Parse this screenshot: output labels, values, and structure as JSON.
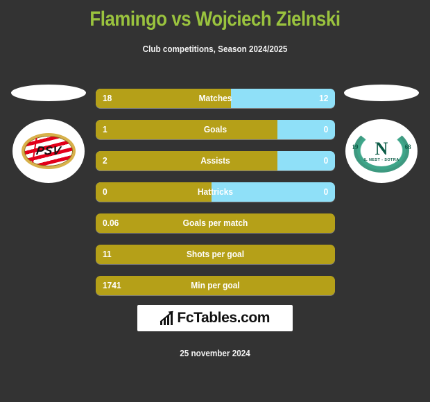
{
  "page": {
    "background_color": "#333333",
    "title": "Flamingo vs Wojciech Zielnski",
    "title_color": "#9ac33e",
    "subtitle": "Club competitions, Season 2024/2025",
    "date": "25 november 2024"
  },
  "colors": {
    "home_bar": "#b5a018",
    "away_bar": "#8fe0f8",
    "text": "#ffffff"
  },
  "teams": {
    "home": {
      "crest_name": "psv-crest",
      "wordmark": "PSV"
    },
    "away": {
      "crest_name": "nest-sotra-crest",
      "initial": "N",
      "year_left": "19",
      "year_right": "68",
      "club_name": "IL NEST - SOTRA"
    }
  },
  "chart_data": {
    "type": "bar",
    "title": "Flamingo vs Wojciech Zielnski",
    "subtitle": "Club competitions, Season 2024/2025",
    "orientation": "horizontal-diverging",
    "series": [
      {
        "name": "Flamingo",
        "color": "#b5a018"
      },
      {
        "name": "Wojciech Zielnski",
        "color": "#8fe0f8"
      }
    ],
    "categories": [
      "Matches",
      "Goals",
      "Assists",
      "Hattricks",
      "Goals per match",
      "Shots per goal",
      "Min per goal"
    ],
    "rows": [
      {
        "label": "Matches",
        "home": "18",
        "away": "12",
        "home_pct": 56.5,
        "two_sided": true
      },
      {
        "label": "Goals",
        "home": "1",
        "away": "0",
        "home_pct": 76.0,
        "two_sided": true
      },
      {
        "label": "Assists",
        "home": "2",
        "away": "0",
        "home_pct": 76.0,
        "two_sided": true
      },
      {
        "label": "Hattricks",
        "home": "0",
        "away": "0",
        "home_pct": 48.5,
        "two_sided": true
      },
      {
        "label": "Goals per match",
        "home": "0.06",
        "away": "",
        "home_pct": 100,
        "two_sided": false
      },
      {
        "label": "Shots per goal",
        "home": "11",
        "away": "",
        "home_pct": 100,
        "two_sided": false
      },
      {
        "label": "Min per goal",
        "home": "1741",
        "away": "",
        "home_pct": 100,
        "two_sided": false
      }
    ]
  },
  "footer": {
    "brand": "FcTables.com",
    "brand_icon": "bar-chart-icon",
    "date": "25 november 2024"
  }
}
